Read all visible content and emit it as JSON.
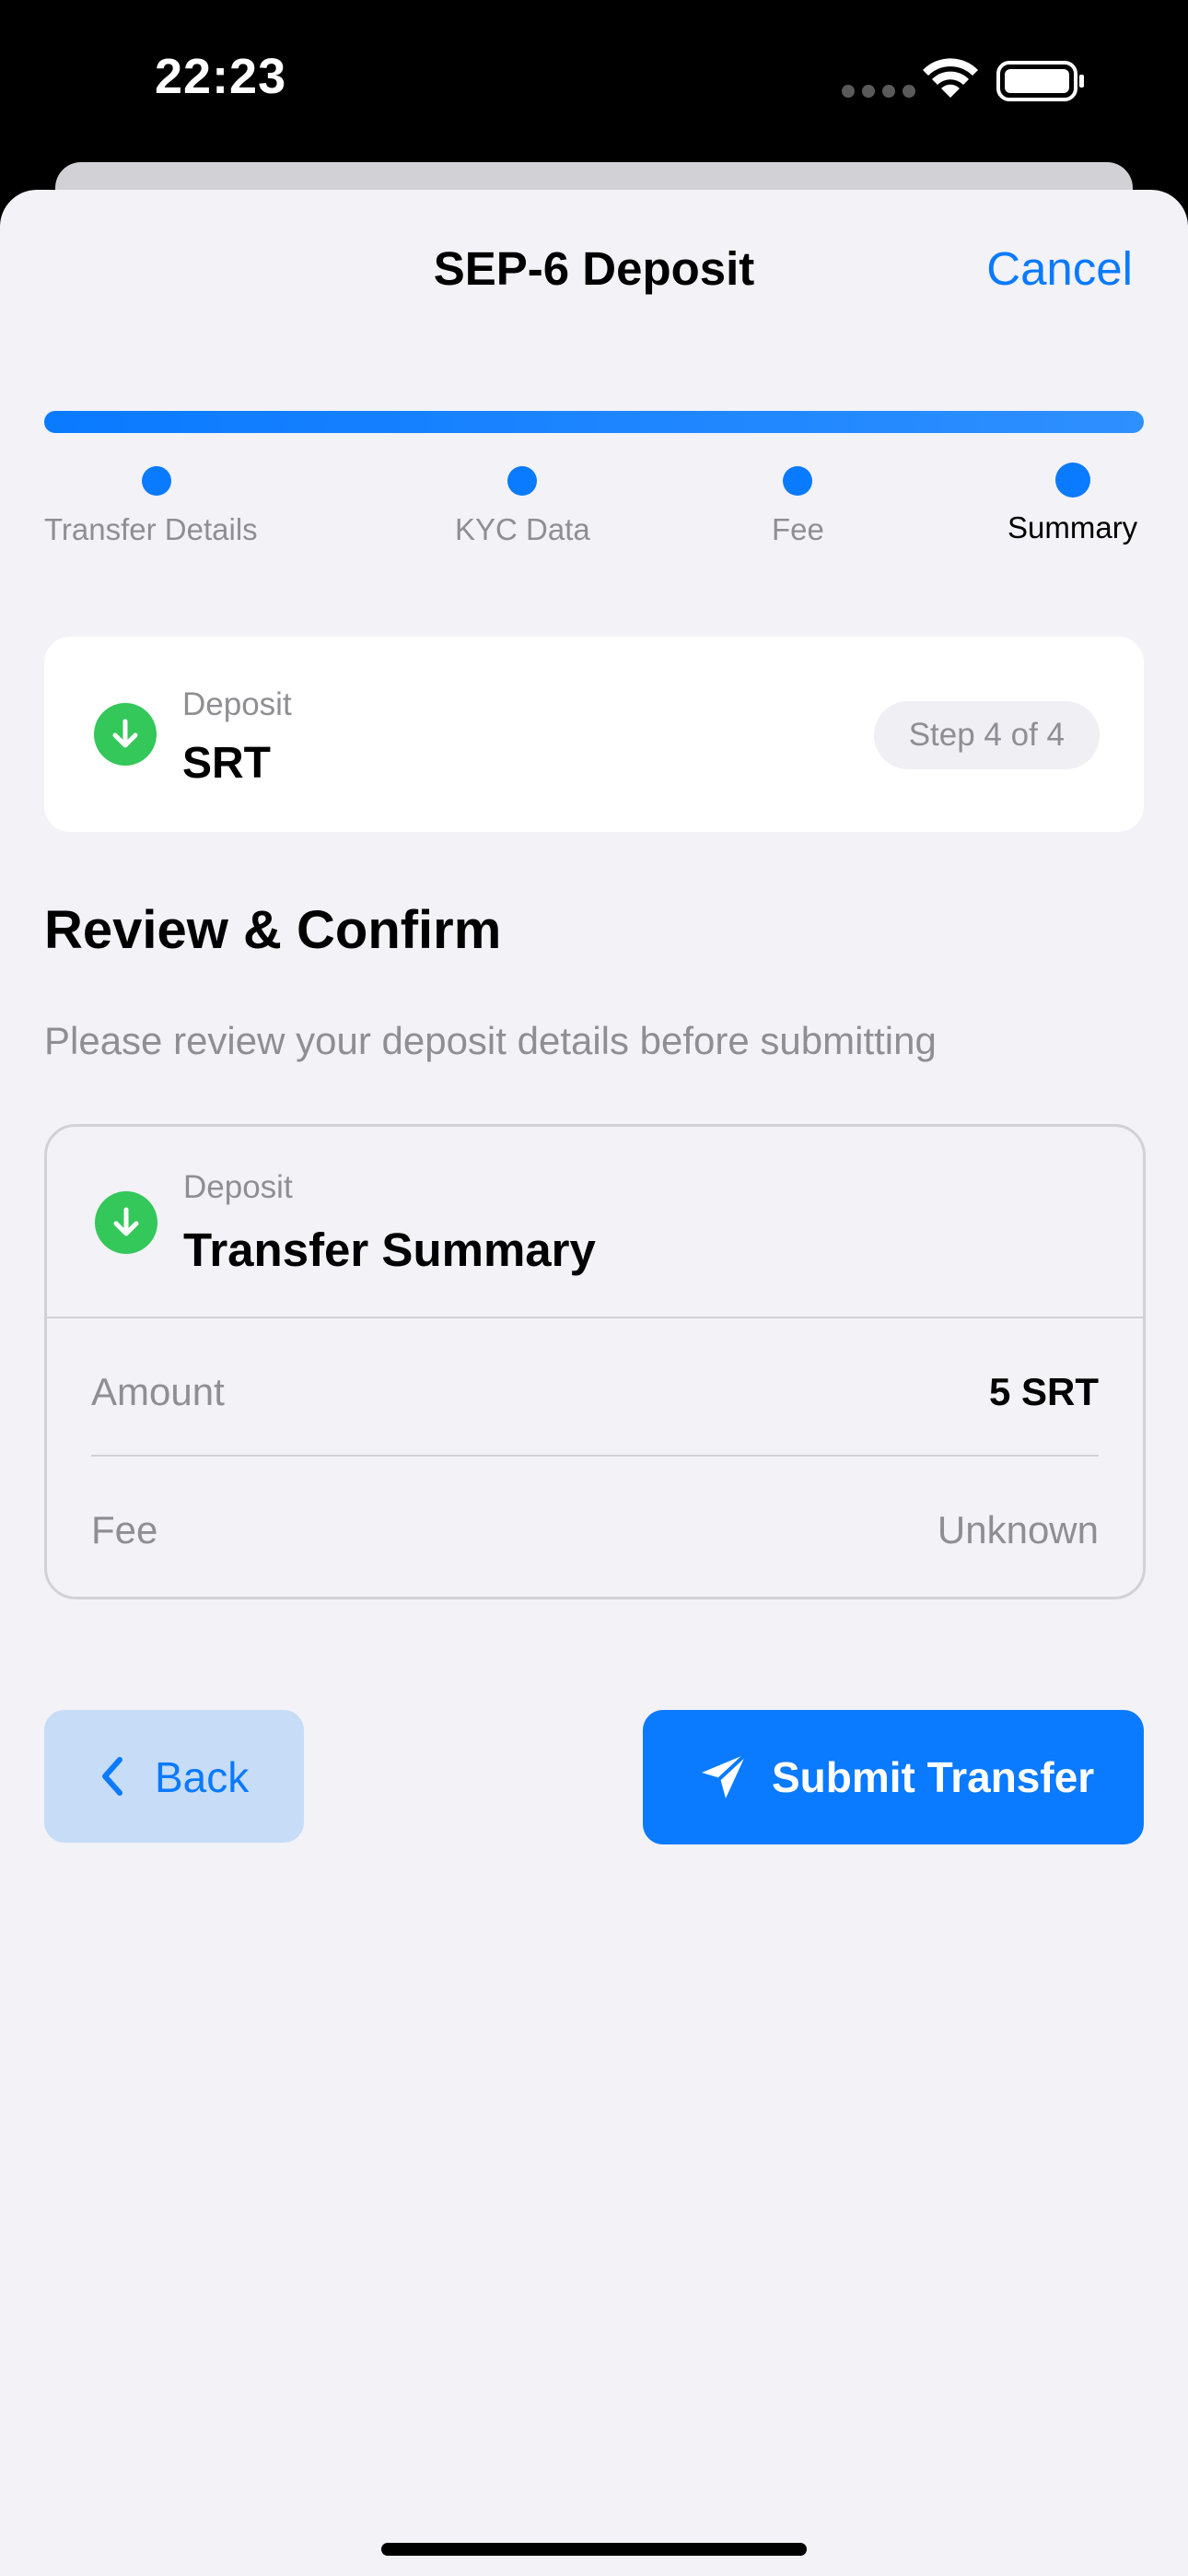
{
  "status_bar": {
    "time": "22:23"
  },
  "nav": {
    "title": "SEP-6 Deposit",
    "cancel_label": "Cancel"
  },
  "progress": {
    "current_step": 4,
    "total_steps": 4,
    "steps": [
      {
        "label": "Transfer Details",
        "completed": true
      },
      {
        "label": "KYC Data",
        "completed": true
      },
      {
        "label": "Fee",
        "completed": true
      },
      {
        "label": "Summary",
        "completed": true,
        "active": true
      }
    ]
  },
  "asset_card": {
    "kicker": "Deposit",
    "asset": "SRT",
    "step_badge": "Step 4 of 4",
    "icon": "arrow-down-circle-icon"
  },
  "review": {
    "title": "Review & Confirm",
    "subtitle": "Please review your deposit details before submitting"
  },
  "summary": {
    "kicker": "Deposit",
    "title": "Transfer Summary",
    "icon": "arrow-down-circle-icon",
    "rows": [
      {
        "label": "Amount",
        "value": "5 SRT"
      },
      {
        "label": "Fee",
        "value": "Unknown"
      }
    ]
  },
  "actions": {
    "back_label": "Back",
    "submit_label": "Submit Transfer"
  },
  "colors": {
    "accent": "#0a7aff",
    "success": "#34c759",
    "background": "#f2f2f7"
  }
}
